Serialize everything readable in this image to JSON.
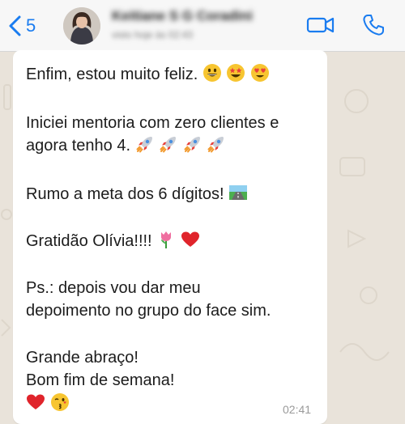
{
  "header": {
    "back_count": "5",
    "contact_name": "Keitiane S G Coradini",
    "contact_status": "visto hoje às 02:43"
  },
  "message": {
    "line1": "Enfim, estou muito feliz.",
    "line2": "Iniciei mentoria com zero clientes e",
    "line3": "agora tenho 4.",
    "line4": "Rumo a meta dos 6 dígitos!",
    "line5": "Gratidão Olívia!!!!",
    "line6": "Ps.: depois vou dar meu",
    "line7": "depoimento no grupo do face sim.",
    "line8": "Grande abraço!",
    "line9": "Bom fim de semana!",
    "time": "02:41"
  },
  "icons": {
    "back": "chevron-left-icon",
    "video": "video-camera-icon",
    "call": "phone-icon",
    "line1_emojis": [
      "grinning-face-icon",
      "star-struck-face-icon",
      "heart-eyes-face-icon"
    ],
    "line3_emojis": [
      "rocket-icon",
      "rocket-icon",
      "rocket-icon",
      "rocket-icon"
    ],
    "line4_emoji": "motorway-icon",
    "line5_emojis": [
      "tulip-icon",
      "red-heart-icon"
    ],
    "line10_emojis": [
      "red-heart-icon",
      "kissing-face-icon"
    ]
  },
  "colors": {
    "accent": "#1a7cf0",
    "bubble": "#ffffff",
    "wallpaper": "#e9e3da",
    "header": "#f7f7f7"
  }
}
